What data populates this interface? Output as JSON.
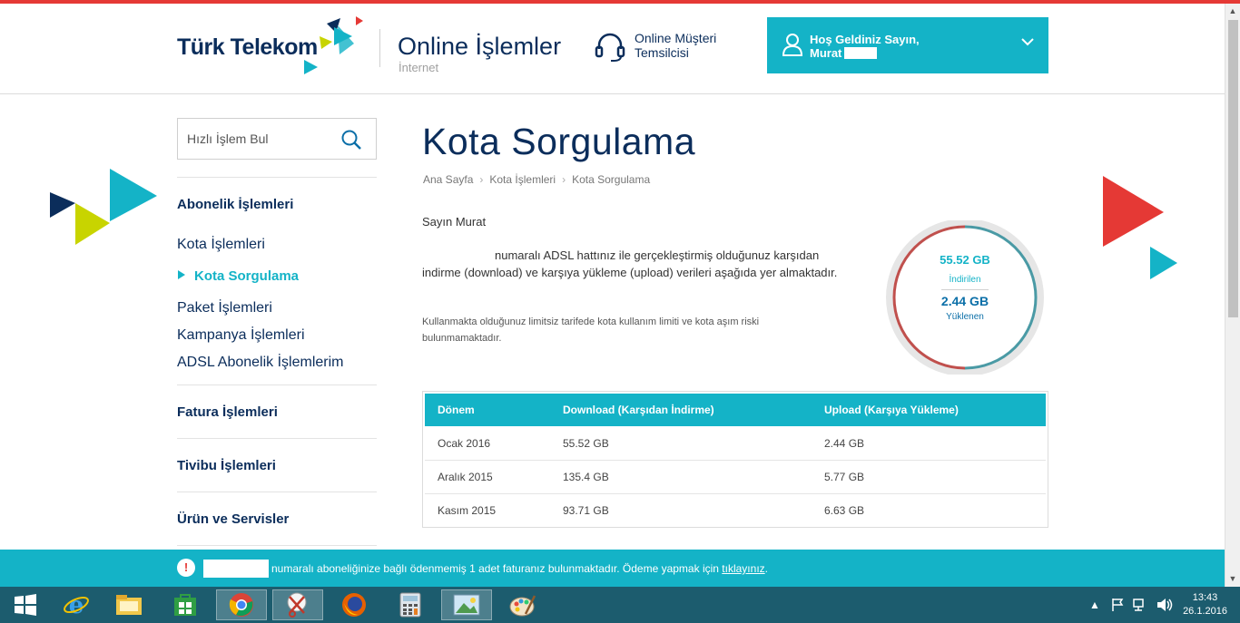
{
  "header": {
    "logo": "Türk Telekom",
    "app_title": "Online İşlemler",
    "app_subtitle": "İnternet",
    "support_line1": "Online Müşteri",
    "support_line2": "Temsilcisi",
    "welcome_line1": "Hoş Geldiniz Sayın,",
    "welcome_line2": "Murat"
  },
  "search": {
    "placeholder": "Hızlı İşlem Bul"
  },
  "sidebar": {
    "abonelik_head": "Abonelik İşlemleri",
    "kota": "Kota İşlemleri",
    "kota_sorgulama": "Kota Sorgulama",
    "paket": "Paket İşlemleri",
    "kampanya": "Kampanya İşlemleri",
    "adsl": "ADSL Abonelik İşlemlerim",
    "fatura": "Fatura İşlemleri",
    "tivibu": "Tivibu İşlemleri",
    "urun": "Ürün ve Servisler"
  },
  "main": {
    "title": "Kota Sorgulama",
    "breadcrumb": [
      "Ana Sayfa",
      "Kota İşlemleri",
      "Kota Sorgulama"
    ],
    "greeting": "Sayın Murat",
    "info": "numaralı ADSL hattınız ile gerçekleştirmiş olduğunuz karşıdan indirme (download) ve karşıya yükleme (upload) verileri aşağıda yer almaktadır.",
    "note": "Kullanmakta olduğunuz limitsiz tarifede kota kullanım limiti ve kota aşım riski bulunmamaktadır."
  },
  "gauge": {
    "download_value": "55.52 GB",
    "download_label": "İndirilen",
    "upload_value": "2.44 GB",
    "upload_label": "Yüklenen",
    "download_color": "#14b3c7",
    "upload_color": "#c0504d"
  },
  "table": {
    "headers": [
      "Dönem",
      "Download (Karşıdan İndirme)",
      "Upload (Karşıya Yükleme)"
    ],
    "rows": [
      [
        "Ocak 2016",
        "55.52 GB",
        "2.44 GB"
      ],
      [
        "Aralık 2015",
        "135.4 GB",
        "5.77 GB"
      ],
      [
        "Kasım 2015",
        "93.71 GB",
        "6.63 GB"
      ]
    ]
  },
  "notification": {
    "text": "numaralı aboneliğinize bağlı ödenmemiş 1 adet faturanız bulunmaktadır. Ödeme yapmak için",
    "link": "tıklayınız",
    "end": "."
  },
  "taskbar": {
    "apps": [
      "windows-start",
      "internet-explorer",
      "file-explorer",
      "store",
      "chrome",
      "snipping-tool",
      "firefox",
      "calculator",
      "photos",
      "paint"
    ],
    "time": "13:43",
    "date": "26.1.2016"
  },
  "colors": {
    "brand_navy": "#0b2d5b",
    "accent_teal": "#14b3c7",
    "accent_red": "#e53935"
  }
}
